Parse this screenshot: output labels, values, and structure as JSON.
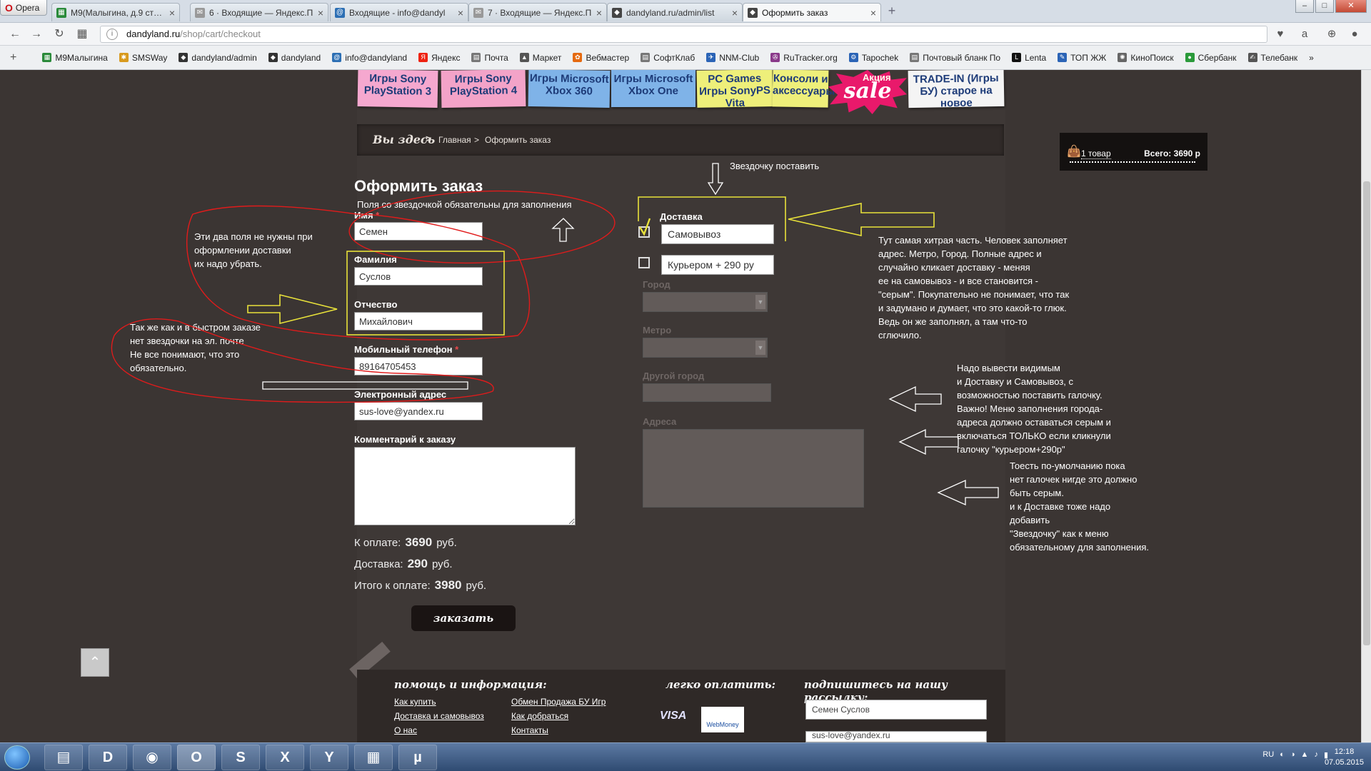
{
  "browser": {
    "menu_label": "Opera",
    "tabs": [
      {
        "label": "М9(Малыгина, д.9 стр.2,",
        "color": "#2a8a3a"
      },
      {
        "label": "6 · Входящие — Яндекс.П",
        "color": "#888888"
      },
      {
        "label": "Входящие - info@dandyl",
        "color": "#2c6fb4"
      },
      {
        "label": "7 · Входящие — Яндекс.П",
        "color": "#888888"
      },
      {
        "label": "dandyland.ru/admin/list",
        "color": "#333333"
      },
      {
        "label": "Оформить заказ",
        "color": "#333333"
      }
    ],
    "url_host": "dandyland.ru",
    "url_path": "/shop/cart/checkout",
    "bookmarks": [
      "М9Малыгина",
      "SMSWay",
      "dandyland/admin",
      "dandyland",
      "info@dandyland",
      "Яндекс",
      "Почта",
      "Маркет",
      "Вебмастер",
      "СофтКлаб",
      "NNM-Club",
      "RuTracker.org",
      "Tapochek",
      "Почтовый бланк По",
      "Lenta",
      "ТОП ЖЖ",
      "КиноПоиск",
      "Сбербанк",
      "Телебанк"
    ]
  },
  "nav": {
    "categories": [
      {
        "label": "Игры Sony PlayStation 3",
        "color": "#f5a8cf"
      },
      {
        "label": "Игры Sony PlayStation 4",
        "color": "#f3a3c8"
      },
      {
        "label": "Игры Microsoft Xbox 360",
        "color": "#7fb3e8"
      },
      {
        "label": "Игры Microsoft Xbox One",
        "color": "#7fb3e8"
      },
      {
        "label": "PC Games Игры SonyPS Vita",
        "color": "#eeef7a"
      },
      {
        "label": "Консоли и аксессуары",
        "color": "#eeef7a"
      },
      {
        "label": "TRADE-IN (Игры БУ) старое на новое",
        "color": "#f4f4f4"
      }
    ],
    "sale_label": "sale",
    "sale_top": "Акция"
  },
  "breadcrumb": {
    "here": "Вы здесь",
    "sep": ">",
    "home": "Главная",
    "current": "Оформить заказ"
  },
  "cart": {
    "items": "1 товар",
    "total": "Всего: 3690 р"
  },
  "form": {
    "title": "Оформить заказ",
    "required_note": "Поля со звездочкой обязательны для заполнения",
    "first_name": {
      "label": "Имя",
      "value": "Семен"
    },
    "last_name": {
      "label": "Фамилия",
      "value": "Суслов"
    },
    "middle_name": {
      "label": "Отчество",
      "value": "Михайлович"
    },
    "phone": {
      "label": "Мобильный телефон",
      "value": "89164705453"
    },
    "email": {
      "label": "Электронный адрес",
      "value": "sus-love@yandex.ru"
    },
    "comment": {
      "label": "Комментарий к заказу",
      "value": ""
    },
    "star": "*"
  },
  "delivery": {
    "title": "Доставка",
    "option_pickup": "Самовывоз",
    "option_courier": "Курьером + 290 ру",
    "city_label": "Город",
    "metro_label": "Метро",
    "other_city_label": "Другой город",
    "address_label": "Адреса"
  },
  "summary": {
    "pay_label": "К оплате:",
    "pay_value": "3690",
    "pay_unit": "руб.",
    "delivery_label": "Доставка:",
    "delivery_value": "290",
    "delivery_unit": "руб.",
    "total_label": "Итого к оплате:",
    "total_value": "3980",
    "total_unit": "руб.",
    "order_button": "заказать"
  },
  "annotations": {
    "star_hint": "Звездочку поставить",
    "remove_fields": "Эти два поля не нужны при\nоформлении доставки\nих надо убрать.",
    "email_star": "Так же как и в быстром заказе\nнет звездочки на эл. почте\nНе все понимают, что это\nобязательно.",
    "tricky": "Тут самая хитрая часть. Человек заполняет\nадрес. Метро, Город. Полные адрес и\nслучайно кликает доставку - меняя\nее на самовывоз - и все становится -\n\"серым\". Покупательно не понимает, что так\nи задумано и думает, что это какой-то глюк.\nВедь он же заполнял, а там что-то\nсглючило.",
    "show_both": "Надо вывести видимым\nи Доставку и Самовывоз, с\nвозможностью поставить галочку.\nВажно! Меню заполнения города-\nадреса должно оставаться серым и\nвключаться ТОЛЬКО если кликнули\nгалочку \"курьером+290р\"",
    "default_grey": "Тоесть по-умолчанию пока\nнет галочек нигде это должно\nбыть серым.\nи к Доставке тоже надо\nдобавить\n\"Звездочку\" как к меню\nобязательному для заполнения."
  },
  "footer": {
    "help_title": "помощь и информация:",
    "links_col1": [
      "Как купить",
      "Доставка и самовывоз",
      "О нас"
    ],
    "links_col2": [
      "Обмен Продажа БУ Игр",
      "Как добраться",
      "Контакты"
    ],
    "pay_title": "легко оплатить:",
    "visa": "VISA",
    "webmoney": "WebMoney",
    "subscribe_title": "подпишитесь на нашу рассылку:",
    "sub_name": "Семен Суслов",
    "sub_email": "sus-love@yandex.ru"
  },
  "taskbar": {
    "lang": "RU",
    "time": "12:18",
    "date": "07.05.2015"
  }
}
